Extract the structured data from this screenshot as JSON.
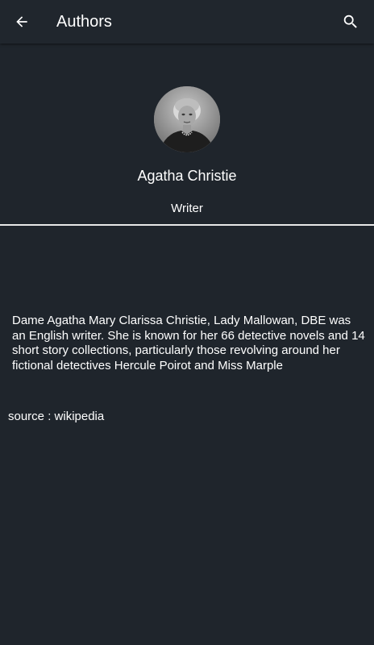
{
  "toolbar": {
    "title": "Authors",
    "back_icon": "arrow-left-icon",
    "search_icon": "search-icon"
  },
  "author": {
    "name": "Agatha Christie",
    "role": "Writer",
    "bio": "Dame Agatha Mary Clarissa Christie, Lady Mallowan, DBE was an English writer. She is known for her 66 detective novels and 14 short story collections, particularly those revolving around her fictional detectives Hercule Poirot and Miss Marple",
    "source": "source : wikipedia"
  },
  "colors": {
    "background": "#1f252c",
    "toolbar": "#20262d",
    "text": "#ffffff",
    "divider": "#e8e8e8"
  }
}
